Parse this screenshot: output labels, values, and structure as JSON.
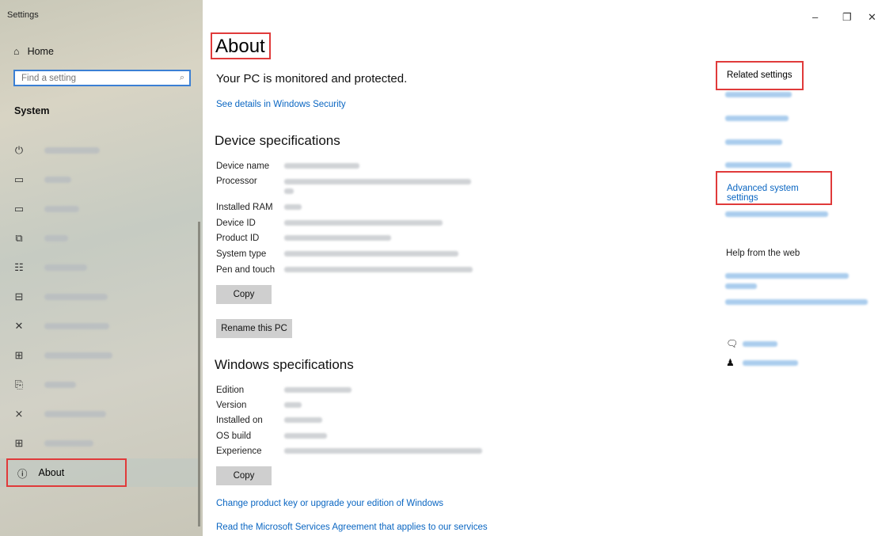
{
  "window": {
    "title": "Settings",
    "controls": {
      "minimize": "–",
      "restore": "❐",
      "close": "✕"
    }
  },
  "sidebar": {
    "home_label": "Home",
    "search": {
      "placeholder": "Find a setting"
    },
    "section": "System",
    "items": [
      {
        "icon": "power-icon"
      },
      {
        "icon": "display-icon"
      },
      {
        "icon": "battery-icon"
      },
      {
        "icon": "storage-icon"
      },
      {
        "icon": "tablet-icon"
      },
      {
        "icon": "multitasking-icon"
      },
      {
        "icon": "projecting-icon"
      },
      {
        "icon": "shared-experiences-icon"
      },
      {
        "icon": "clipboard-icon"
      },
      {
        "icon": "remote-desktop-icon"
      },
      {
        "icon": "optional-icon"
      }
    ],
    "about_label": "About",
    "about_icon": "info-icon"
  },
  "main": {
    "title": "About",
    "protection_status": "Your PC is monitored and protected.",
    "security_link": "See details in Windows Security",
    "device_specs": {
      "heading": "Device specifications",
      "labels": [
        "Device name",
        "Processor",
        "Installed RAM",
        "Device ID",
        "Product ID",
        "System type",
        "Pen and touch"
      ],
      "copy_label": "Copy",
      "rename_label": "Rename this PC"
    },
    "windows_specs": {
      "heading": "Windows specifications",
      "labels": [
        "Edition",
        "Version",
        "Installed on",
        "OS build",
        "Experience"
      ],
      "copy_label": "Copy"
    },
    "links": {
      "product_key": "Change product key or upgrade your edition of Windows",
      "services_agreement": "Read the Microsoft Services Agreement that applies to our services"
    }
  },
  "right_panel": {
    "related_heading": "Related settings",
    "advanced_system_settings": "Advanced system settings",
    "help_heading": "Help from the web"
  },
  "colors": {
    "accent": "#0a66c2",
    "highlight_box": "#e03a3a"
  }
}
